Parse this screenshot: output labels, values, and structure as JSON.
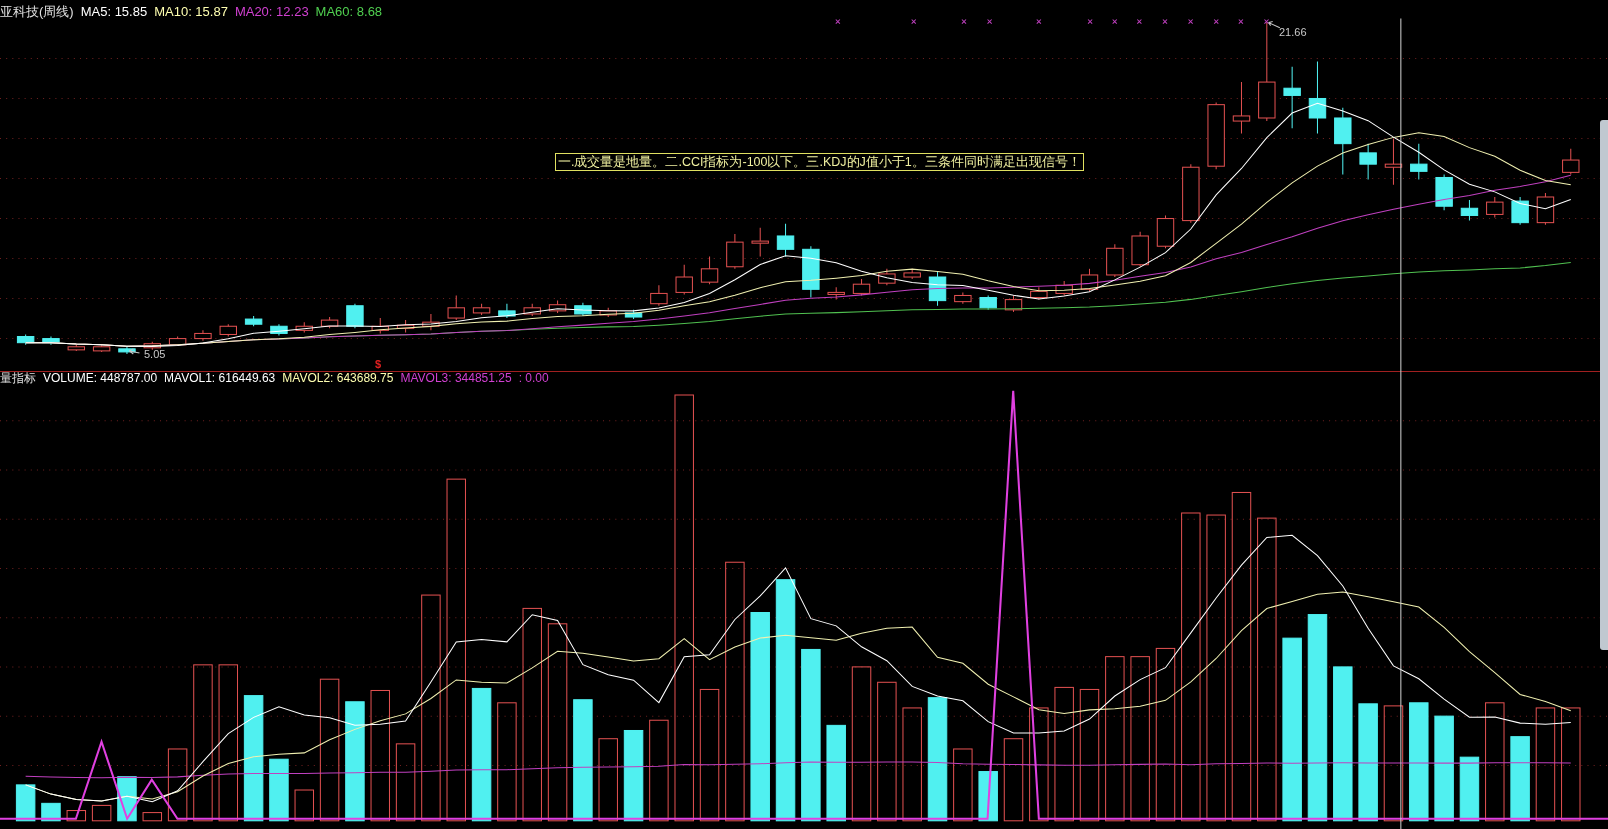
{
  "price_panel": {
    "title": "亚科技(周线)",
    "indicators": [
      {
        "label": "MA5: 15.85",
        "color": "#ffffff"
      },
      {
        "label": "MA10: 15.87",
        "color": "#ffffb0"
      },
      {
        "label": "MA20: 12.23",
        "color": "#d040d0"
      },
      {
        "label": "MA60: 8.68",
        "color": "#50d050"
      }
    ],
    "high_label": "21.66",
    "low_label": "5.05",
    "signal_mark": "$",
    "note": "一.成交量是地量。二.CCI指标为-100以下。三.KDJ的J值小于1。三条件同时满足出现信号！"
  },
  "volume_panel": {
    "title": "量指标",
    "indicators": [
      {
        "label": "VOLUME: 448787.00",
        "color": "#ffffff"
      },
      {
        "label": "MAVOL1: 616449.63",
        "color": "#ffffff"
      },
      {
        "label": "MAVOL2: 643689.75",
        "color": "#ffffb0"
      },
      {
        "label": "MAVOL3: 344851.25",
        "color": "#d040d0"
      },
      {
        "label": ": 0.00",
        "color": "#d040d0"
      }
    ]
  }
}
